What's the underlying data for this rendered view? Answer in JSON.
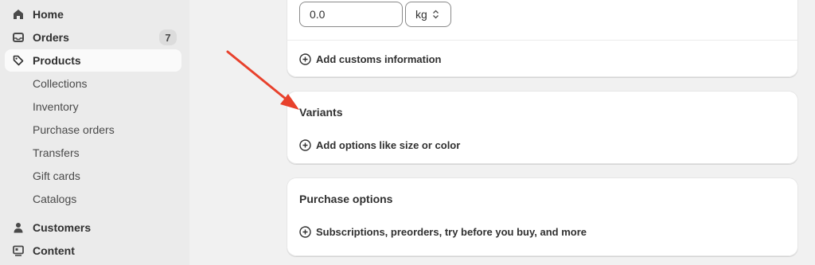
{
  "sidebar": {
    "items": [
      {
        "label": "Home",
        "icon": "home-icon"
      },
      {
        "label": "Orders",
        "icon": "orders-inbox-icon",
        "badge": "7"
      },
      {
        "label": "Products",
        "icon": "tag-icon",
        "active": true
      }
    ],
    "sub_items": [
      {
        "label": "Collections"
      },
      {
        "label": "Inventory"
      },
      {
        "label": "Purchase orders"
      },
      {
        "label": "Transfers"
      },
      {
        "label": "Gift cards"
      },
      {
        "label": "Catalogs"
      }
    ],
    "bottom_items": [
      {
        "label": "Customers",
        "icon": "person-icon"
      },
      {
        "label": "Content",
        "icon": "content-icon"
      }
    ]
  },
  "shipping": {
    "weight_value": "0.0",
    "weight_unit": "kg",
    "customs_action": "Add customs information"
  },
  "variants": {
    "title": "Variants",
    "action": "Add options like size or color"
  },
  "purchase_options": {
    "title": "Purchase options",
    "action": "Subscriptions, preorders, try before you buy, and more"
  },
  "colors": {
    "accent_arrow": "#e8412c",
    "active_nav_bg": "#fafafa",
    "sidebar_bg": "#ebebeb"
  }
}
